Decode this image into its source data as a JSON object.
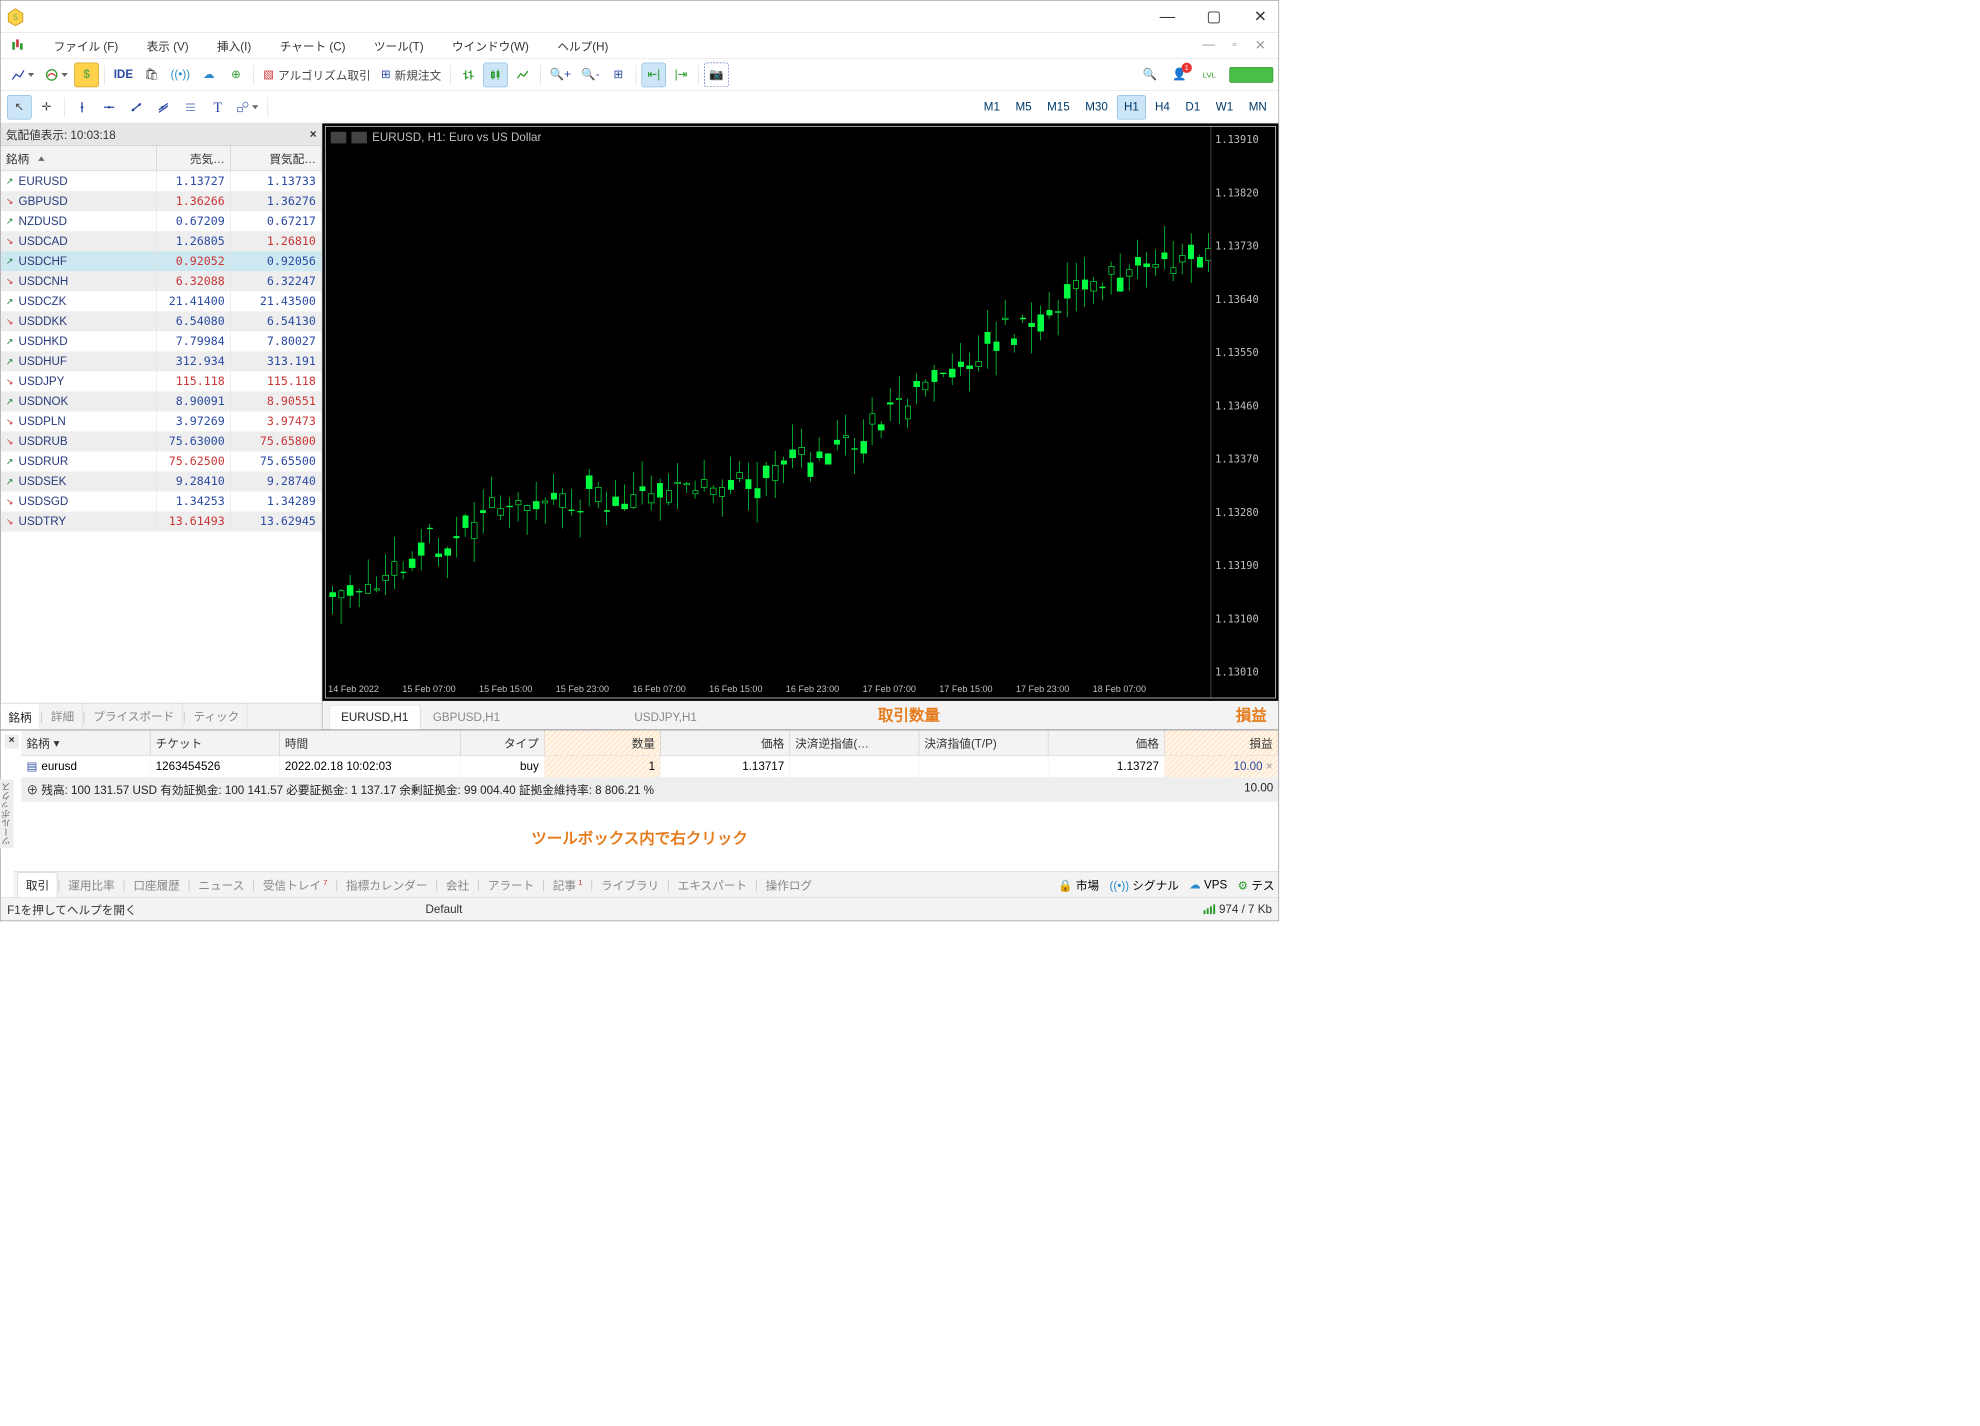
{
  "menu": [
    "ファイル (F)",
    "表示 (V)",
    "挿入(I)",
    "チャート (C)",
    "ツール(T)",
    "ウインドウ(W)",
    "ヘルプ(H)"
  ],
  "toolbar1": {
    "algo": "アルゴリズム取引",
    "new_order": "新規注文",
    "ide": "IDE",
    "notif_count": "1"
  },
  "timeframes": [
    "M1",
    "M5",
    "M15",
    "M30",
    "H1",
    "H4",
    "D1",
    "W1",
    "MN"
  ],
  "active_tf": "H1",
  "mw_title": "気配値表示: 10:03:18",
  "mw_cols": [
    "銘柄",
    "売気…",
    "買気配…"
  ],
  "mw_rows": [
    {
      "sym": "EURUSD",
      "dir": "up",
      "bid": "1.13727",
      "ask": "1.13733",
      "bidc": "b",
      "askc": "b"
    },
    {
      "sym": "GBPUSD",
      "dir": "down",
      "bid": "1.36266",
      "ask": "1.36276",
      "bidc": "r",
      "askc": "b"
    },
    {
      "sym": "NZDUSD",
      "dir": "up",
      "bid": "0.67209",
      "ask": "0.67217",
      "bidc": "b",
      "askc": "b"
    },
    {
      "sym": "USDCAD",
      "dir": "down",
      "bid": "1.26805",
      "ask": "1.26810",
      "bidc": "b",
      "askc": "r"
    },
    {
      "sym": "USDCHF",
      "dir": "up",
      "bid": "0.92052",
      "ask": "0.92056",
      "bidc": "r",
      "askc": "b",
      "hl": true
    },
    {
      "sym": "USDCNH",
      "dir": "down",
      "bid": "6.32088",
      "ask": "6.32247",
      "bidc": "r",
      "askc": "b"
    },
    {
      "sym": "USDCZK",
      "dir": "up",
      "bid": "21.41400",
      "ask": "21.43500",
      "bidc": "b",
      "askc": "b"
    },
    {
      "sym": "USDDKK",
      "dir": "down",
      "bid": "6.54080",
      "ask": "6.54130",
      "bidc": "b",
      "askc": "b"
    },
    {
      "sym": "USDHKD",
      "dir": "up",
      "bid": "7.79984",
      "ask": "7.80027",
      "bidc": "b",
      "askc": "b"
    },
    {
      "sym": "USDHUF",
      "dir": "up",
      "bid": "312.934",
      "ask": "313.191",
      "bidc": "b",
      "askc": "b"
    },
    {
      "sym": "USDJPY",
      "dir": "down",
      "bid": "115.118",
      "ask": "115.118",
      "bidc": "r",
      "askc": "r"
    },
    {
      "sym": "USDNOK",
      "dir": "up",
      "bid": "8.90091",
      "ask": "8.90551",
      "bidc": "b",
      "askc": "r"
    },
    {
      "sym": "USDPLN",
      "dir": "down",
      "bid": "3.97269",
      "ask": "3.97473",
      "bidc": "b",
      "askc": "r"
    },
    {
      "sym": "USDRUB",
      "dir": "down",
      "bid": "75.63000",
      "ask": "75.65800",
      "bidc": "b",
      "askc": "r"
    },
    {
      "sym": "USDRUR",
      "dir": "up",
      "bid": "75.62500",
      "ask": "75.65500",
      "bidc": "r",
      "askc": "b"
    },
    {
      "sym": "USDSEK",
      "dir": "up",
      "bid": "9.28410",
      "ask": "9.28740",
      "bidc": "b",
      "askc": "b"
    },
    {
      "sym": "USDSGD",
      "dir": "down",
      "bid": "1.34253",
      "ask": "1.34289",
      "bidc": "b",
      "askc": "b"
    },
    {
      "sym": "USDTRY",
      "dir": "down",
      "bid": "13.61493",
      "ask": "13.62945",
      "bidc": "r",
      "askc": "b"
    }
  ],
  "mw_tabs": [
    "銘柄",
    "詳細",
    "プライスボード",
    "ティック"
  ],
  "chart_title": "EURUSD, H1:  Euro vs US Dollar",
  "ylabels": [
    "1.13910",
    "1.13820",
    "1.13730",
    "1.13640",
    "1.13550",
    "1.13460",
    "1.13370",
    "1.13280",
    "1.13190",
    "1.13100",
    "1.13010"
  ],
  "xlabels": [
    "14 Feb 2022",
    "15 Feb 07:00",
    "15 Feb 15:00",
    "15 Feb 23:00",
    "16 Feb 07:00",
    "16 Feb 15:00",
    "16 Feb 23:00",
    "17 Feb 07:00",
    "17 Feb 15:00",
    "17 Feb 23:00",
    "18 Feb 07:00"
  ],
  "chart_tabs": [
    "EURUSD,H1",
    "GBPUSD,H1",
    "USDJPY,H1"
  ],
  "orange1": "取引数量",
  "orange2": "損益",
  "orange3": "ツールボックス内で右クリック",
  "tb_cols": [
    "銘柄",
    "チケット",
    "時間",
    "タイプ",
    "数量",
    "価格",
    "決済逆指値(…",
    "決済指値(T/P)",
    "価格",
    "損益"
  ],
  "trade": {
    "sym": "eurusd",
    "ticket": "1263454526",
    "time": "2022.02.18 10:02:03",
    "type": "buy",
    "vol": "1",
    "price": "1.13717",
    "sl": "",
    "tp": "",
    "cur": "1.13727",
    "profit": "10.00"
  },
  "balance": "⊕ 残高: 100 131.57 USD  有効証拠金: 100 141.57  必要証拠金: 1 137.17  余剰証拠金: 99 004.40  証拠金維持率: 8 806.21 %",
  "balance_r": "10.00",
  "tb_tabs": [
    "取引",
    "運用比率",
    "口座履歴",
    "ニュース",
    "受信トレイ",
    "指標カレンダー",
    "会社",
    "アラート",
    "記事",
    "ライブラリ",
    "エキスパート",
    "操作ログ"
  ],
  "tb_badge": {
    "4": "7",
    "8": "1"
  },
  "tb_right": [
    {
      "i": "🔒",
      "t": "市場"
    },
    {
      "i": "((•))",
      "t": "シグナル",
      "c": "#2a8acb"
    },
    {
      "i": "☁",
      "t": "VPS",
      "c": "#2a8acb"
    },
    {
      "i": "⚙",
      "t": "テス",
      "c": "#2a9b2a"
    }
  ],
  "status": {
    "help": "F1を押してヘルプを開く",
    "def": "Default",
    "net": "974 / 7 Kb"
  },
  "chart_data": {
    "type": "candlestick",
    "title": "EURUSD, H1: Euro vs US Dollar",
    "ylim": [
      1.1301,
      1.1391
    ],
    "ylabel": "",
    "xlabel": "",
    "x": [
      "14 Feb 2022",
      "15 Feb 07:00",
      "15 Feb 15:00",
      "15 Feb 23:00",
      "16 Feb 07:00",
      "16 Feb 15:00",
      "16 Feb 23:00",
      "17 Feb 07:00",
      "17 Feb 15:00",
      "17 Feb 23:00",
      "18 Feb 07:00"
    ],
    "candles_note": "OHLC approximated from pixel positions",
    "series": [
      {
        "name": "EURUSD",
        "ohlc": [
          [
            1.1307,
            1.1314,
            1.1303,
            1.1311
          ],
          [
            1.131,
            1.133,
            1.1308,
            1.1326
          ],
          [
            1.1325,
            1.1345,
            1.132,
            1.134
          ],
          [
            1.1338,
            1.136,
            1.1332,
            1.1355
          ],
          [
            1.1354,
            1.1368,
            1.1348,
            1.1362
          ],
          [
            1.1361,
            1.1388,
            1.1356,
            1.1384
          ],
          [
            1.1385,
            1.1395,
            1.1335,
            1.136
          ],
          [
            1.136,
            1.1375,
            1.134,
            1.1368
          ],
          [
            1.1367,
            1.138,
            1.1358,
            1.1373
          ],
          [
            1.1372,
            1.1378,
            1.136,
            1.137
          ],
          [
            1.1369,
            1.1376,
            1.1362,
            1.1373
          ]
        ]
      }
    ]
  }
}
